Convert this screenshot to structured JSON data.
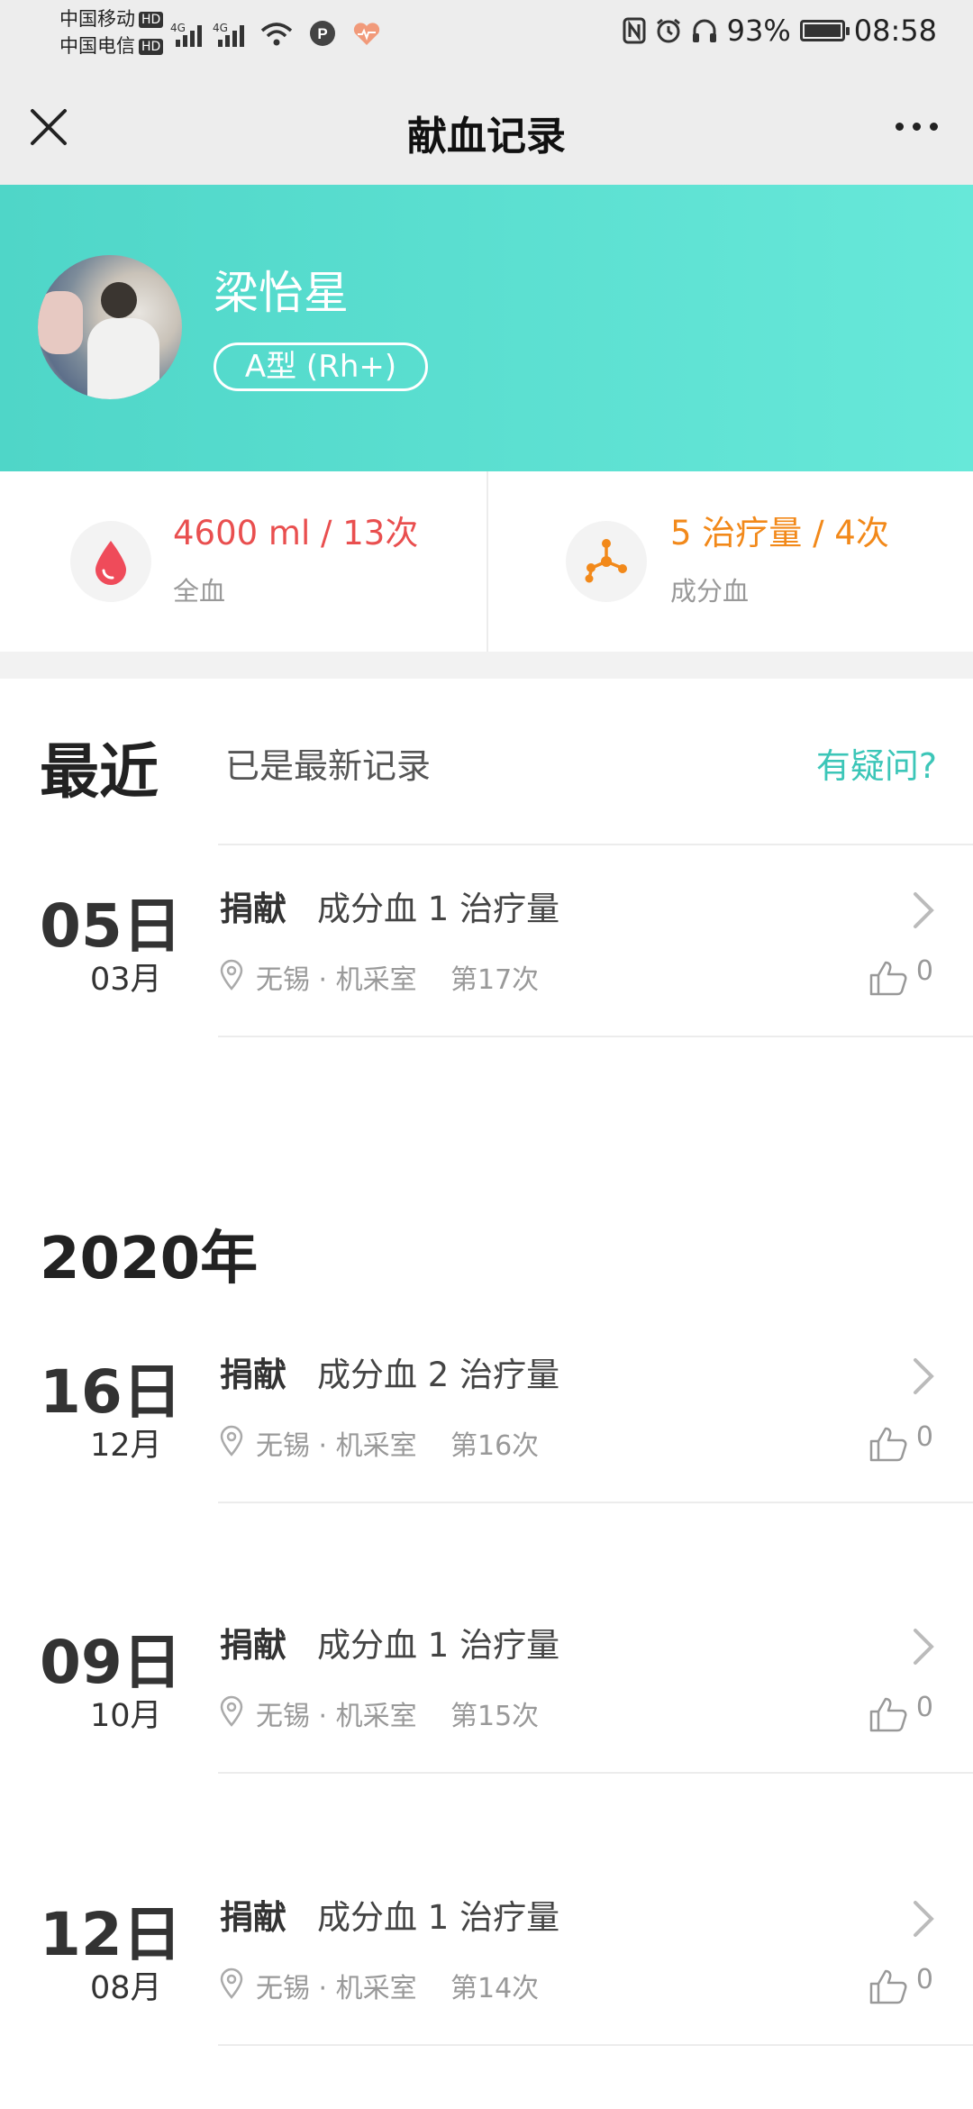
{
  "status_bar": {
    "carrier1": "中国移动",
    "carrier2": "中国电信",
    "hd": "HD",
    "net1": "4G",
    "net2": "4G",
    "battery": "93%",
    "time": "08:58"
  },
  "nav": {
    "title": "献血记录"
  },
  "profile": {
    "name": "梁怡星",
    "blood_type": "A型 (Rh+)"
  },
  "stats": {
    "whole": {
      "value": "4600 ml / 13次",
      "label": "全血",
      "color": "#e94f4f"
    },
    "component": {
      "value": "5 治疗量 / 4次",
      "label": "成分血",
      "color": "#f2891a"
    }
  },
  "recent": {
    "title": "最近",
    "subtitle": "已是最新记录",
    "question": "有疑问?"
  },
  "year_label": "2020年",
  "records": [
    {
      "day": "05日",
      "month": "03月",
      "action": "捐献",
      "desc": "成分血 1 治疗量",
      "location": "无锡 · 机采室",
      "count": "第17次",
      "likes": "0"
    },
    {
      "day": "16日",
      "month": "12月",
      "action": "捐献",
      "desc": "成分血 2 治疗量",
      "location": "无锡 · 机采室",
      "count": "第16次",
      "likes": "0"
    },
    {
      "day": "09日",
      "month": "10月",
      "action": "捐献",
      "desc": "成分血 1 治疗量",
      "location": "无锡 · 机采室",
      "count": "第15次",
      "likes": "0"
    },
    {
      "day": "12日",
      "month": "08月",
      "action": "捐献",
      "desc": "成分血 1 治疗量",
      "location": "无锡 · 机采室",
      "count": "第14次",
      "likes": "0"
    }
  ]
}
